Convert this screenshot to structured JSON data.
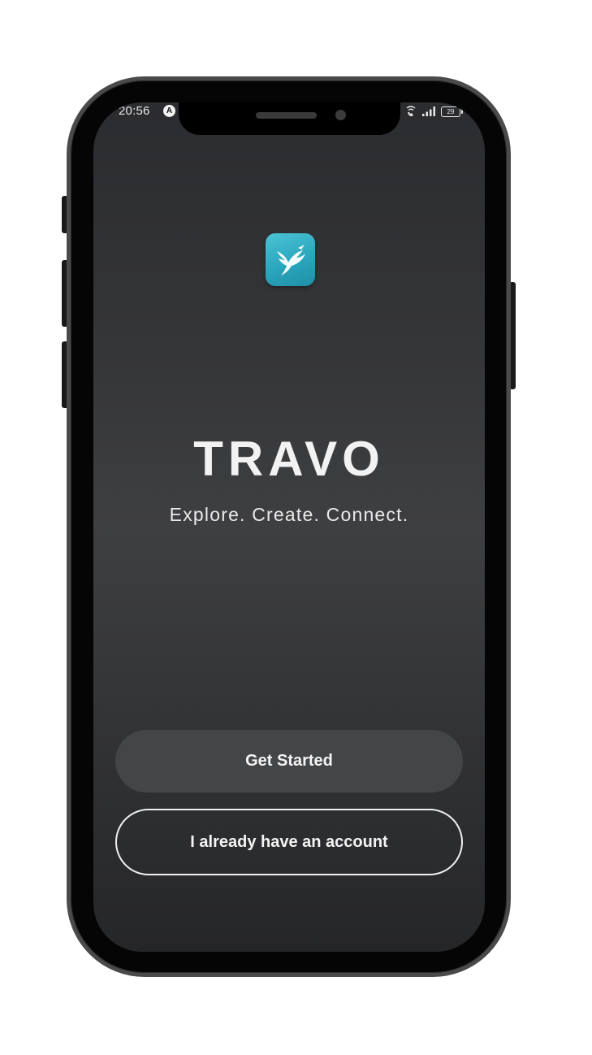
{
  "status_bar": {
    "time": "20:56",
    "app_icon_glyph": "A",
    "battery_level": "29",
    "icons": [
      "wifi-calling-icon",
      "signal-icon",
      "battery-icon"
    ]
  },
  "app": {
    "logo_icon": "hummingbird-logo-icon",
    "brand_color": "#2aa6bd",
    "title": "TRAVO",
    "tagline": "Explore. Create. Connect."
  },
  "actions": {
    "primary_label": "Get Started",
    "secondary_label": "I already have an account"
  }
}
